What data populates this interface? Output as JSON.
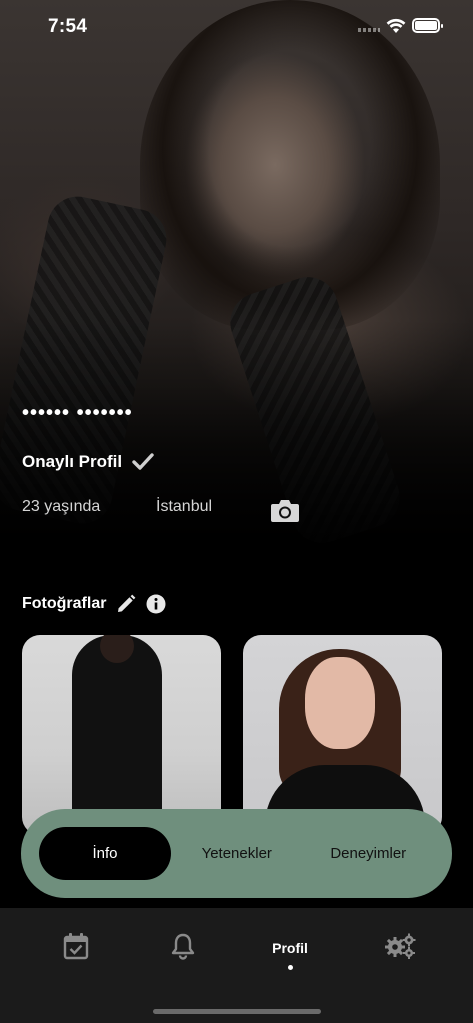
{
  "status_bar": {
    "time": "7:54"
  },
  "profile": {
    "name": "•••••• •••••••",
    "verified_label": "Onaylı Profil",
    "age": "23 yaşında",
    "city": "İstanbul"
  },
  "photos": {
    "title": "Fotoğraflar"
  },
  "segments": [
    {
      "label": "İnfo"
    },
    {
      "label": "Yetenekler"
    },
    {
      "label": "Deneyimler"
    }
  ],
  "tabbar": {
    "profile_label": "Profil"
  },
  "colors": {
    "segment_bg": "#6f8f7d",
    "tabbar_bg": "#1b1b1b",
    "active_segment": "#000000"
  }
}
